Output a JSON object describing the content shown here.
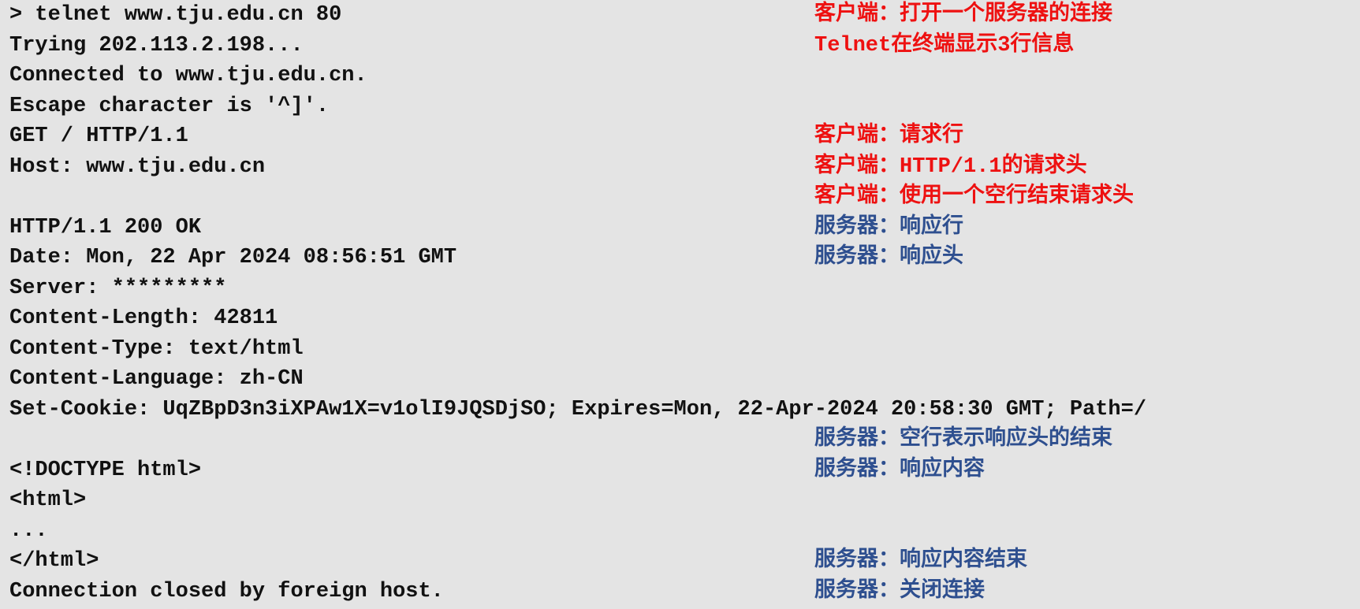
{
  "lines": [
    {
      "text": "> telnet www.tju.edu.cn 80",
      "note": "客户端：打开一个服务器的连接",
      "actor": "client"
    },
    {
      "text": "Trying 202.113.2.198...",
      "note": "Telnet在终端显示3行信息",
      "actor": "client"
    },
    {
      "text": "Connected to www.tju.edu.cn.",
      "note": "",
      "actor": ""
    },
    {
      "text": "Escape character is '^]'.",
      "note": "",
      "actor": ""
    },
    {
      "text": "GET / HTTP/1.1",
      "note": "客户端：请求行",
      "actor": "client"
    },
    {
      "text": "Host: www.tju.edu.cn",
      "note": "客户端：HTTP/1.1的请求头",
      "actor": "client"
    },
    {
      "text": "",
      "note": "客户端：使用一个空行结束请求头",
      "actor": "client"
    },
    {
      "text": "HTTP/1.1 200 OK",
      "note": "服务器：响应行",
      "actor": "server"
    },
    {
      "text": "Date: Mon, 22 Apr 2024 08:56:51 GMT",
      "note": "服务器：响应头",
      "actor": "server"
    },
    {
      "text": "Server: *********",
      "note": "",
      "actor": ""
    },
    {
      "text": "Content-Length: 42811",
      "note": "",
      "actor": ""
    },
    {
      "text": "Content-Type: text/html",
      "note": "",
      "actor": ""
    },
    {
      "text": "Content-Language: zh-CN",
      "note": "",
      "actor": ""
    },
    {
      "text": "Set-Cookie: UqZBpD3n3iXPAw1X=v1olI9JQSDjSO; Expires=Mon, 22-Apr-2024 20:58:30 GMT; Path=/",
      "note": "",
      "actor": ""
    },
    {
      "text": "",
      "note": "服务器：空行表示响应头的结束",
      "actor": "server"
    },
    {
      "text": "<!DOCTYPE html>",
      "note": "服务器：响应内容",
      "actor": "server"
    },
    {
      "text": "<html>",
      "note": "",
      "actor": ""
    },
    {
      "text": "...",
      "note": "",
      "actor": ""
    },
    {
      "text": "</html>",
      "note": "服务器：响应内容结束",
      "actor": "server"
    },
    {
      "text": "Connection closed by foreign host.",
      "note": "服务器：关闭连接",
      "actor": "server"
    }
  ],
  "colors": {
    "background": "#e4e4e4",
    "terminal_text": "#111111",
    "client_note": "#ee1111",
    "server_note": "#2e4f8f"
  }
}
